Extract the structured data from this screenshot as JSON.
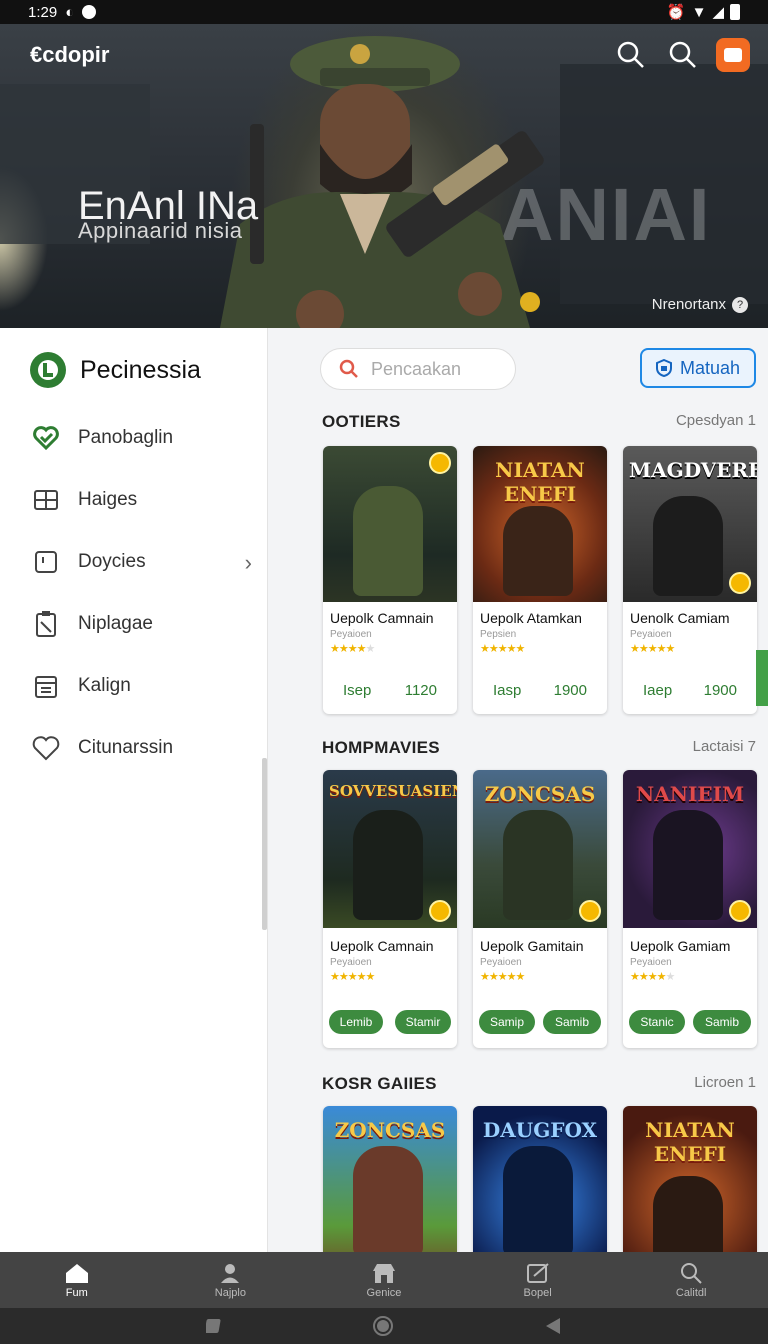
{
  "status": {
    "time": "1:29"
  },
  "hero": {
    "logo": "€cdopir",
    "title": "EnAnl INa",
    "subtitle": "Appinaarid nisia",
    "bigword": "ANIAI",
    "credit": "Nrenortanx",
    "credit_badge": "?"
  },
  "sidebar": {
    "title": "Pecinessia",
    "items": [
      {
        "label": "Panobaglin",
        "icon": "heart-check-icon"
      },
      {
        "label": "Haiges",
        "icon": "grid-icon"
      },
      {
        "label": "Doycies",
        "icon": "document-icon"
      },
      {
        "label": "Niplagae",
        "icon": "clipboard-icon"
      },
      {
        "label": "Kalign",
        "icon": "calendar-icon"
      },
      {
        "label": "Citunarssin",
        "icon": "heart-icon"
      }
    ]
  },
  "main": {
    "search_placeholder": "Pencaakan",
    "button_label": "Matuah",
    "sections": [
      {
        "title": "OOTIERS",
        "right": "Cpesdyan 1",
        "cards": [
          {
            "art": "",
            "name": "Uepolk Camnain",
            "pub": "Peyaioen",
            "rating": 4,
            "left": "Isep",
            "right": "1120"
          },
          {
            "art": "NIATAN ENEFI",
            "name": "Uepolk Atamkan",
            "pub": "Pepsien",
            "rating": 5,
            "left": "Iasp",
            "right": "1900"
          },
          {
            "art": "MAGDVERF",
            "name": "Uenolk Camiam",
            "pub": "Peyaioen",
            "rating": 5,
            "left": "Iaep",
            "right": "1900"
          }
        ]
      },
      {
        "title": "HOMPMAVIES",
        "right": "Lactaisi 7",
        "cards": [
          {
            "art": "SOVVESUASIENI",
            "name": "Uepolk Camnain",
            "pub": "Peyaioen",
            "rating": 5,
            "left": "Lemib",
            "right": "Stamir"
          },
          {
            "art": "ZONCSAS",
            "name": "Uepolk Gamitain",
            "pub": "Peyaioen",
            "rating": 5,
            "left": "Samip",
            "right": "Samib"
          },
          {
            "art": "NANIEIM",
            "name": "Uepolk Gamiam",
            "pub": "Peyaioen",
            "rating": 4,
            "left": "Stanic",
            "right": "Samib"
          }
        ]
      },
      {
        "title": "KOSR GAIIES",
        "right": "Licroen 1",
        "cards": [
          {
            "art": "ZONCSAS"
          },
          {
            "art": "DAUGFOX"
          },
          {
            "art": "NIATAN ENEFI"
          }
        ]
      }
    ]
  },
  "tabs": [
    {
      "label": "Fum",
      "icon": "home-icon"
    },
    {
      "label": "Najplo",
      "icon": "person-icon"
    },
    {
      "label": "Genice",
      "icon": "store-icon"
    },
    {
      "label": "Bopel",
      "icon": "edit-icon"
    },
    {
      "label": "Calitdl",
      "icon": "search-icon"
    }
  ]
}
